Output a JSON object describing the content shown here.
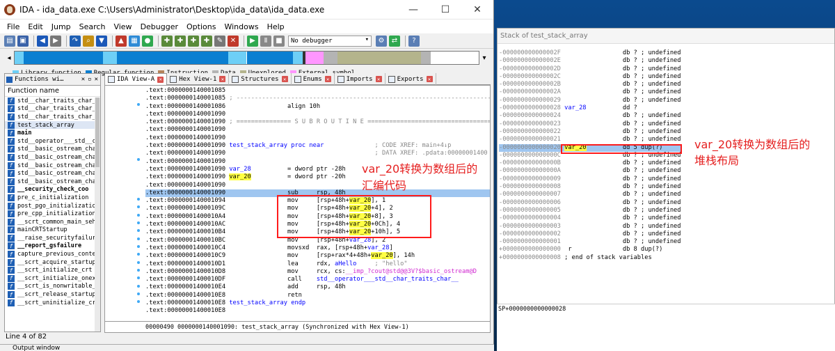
{
  "window": {
    "title": "IDA - ida_data.exe C:\\Users\\Administrator\\Desktop\\ida_data\\ida_data.exe",
    "min": "—",
    "max": "☐",
    "close": "✕"
  },
  "menu": [
    "File",
    "Edit",
    "Jump",
    "Search",
    "View",
    "Debugger",
    "Options",
    "Windows",
    "Help"
  ],
  "toolbar": {
    "debugger_select": "No debugger"
  },
  "legend": [
    {
      "label": "Library function",
      "color": "#6ecff6"
    },
    {
      "label": "Regular function",
      "color": "#0b7fd1"
    },
    {
      "label": "Instruction",
      "color": "#b5835a"
    },
    {
      "label": "Data",
      "color": "#b4b4b4"
    },
    {
      "label": "Unexplored",
      "color": "#b4b48c"
    },
    {
      "label": "External symbol",
      "color": "#ff96ff"
    }
  ],
  "functions": {
    "tab": "Functions wi…",
    "header": "Function name",
    "items": [
      {
        "name": "std__char_traits_char__",
        "bold": false,
        "sel": false
      },
      {
        "name": "std__char_traits_char__",
        "bold": false,
        "sel": false
      },
      {
        "name": "std__char_traits_char__",
        "bold": false,
        "sel": false
      },
      {
        "name": "test_stack_array",
        "bold": false,
        "sel": true
      },
      {
        "name": "main",
        "bold": true,
        "sel": false
      },
      {
        "name": "std__operator___std__ch",
        "bold": false,
        "sel": false
      },
      {
        "name": "std__basic_ostream_char",
        "bold": false,
        "sel": false
      },
      {
        "name": "std__basic_ostream_char",
        "bold": false,
        "sel": false
      },
      {
        "name": "std__basic_ostream_char",
        "bold": false,
        "sel": false
      },
      {
        "name": "std__basic_ostream_char",
        "bold": false,
        "sel": false
      },
      {
        "name": "std__basic_ostream_char",
        "bold": false,
        "sel": false
      },
      {
        "name": "__security_check_coo",
        "bold": true,
        "sel": false
      },
      {
        "name": "pre_c_initialization",
        "bold": false,
        "sel": false
      },
      {
        "name": "post_pgo_initializatio",
        "bold": false,
        "sel": false
      },
      {
        "name": "pre_cpp_initialization",
        "bold": false,
        "sel": false
      },
      {
        "name": "__scrt_common_main_seh",
        "bold": false,
        "sel": false
      },
      {
        "name": "mainCRTStartup",
        "bold": false,
        "sel": false
      },
      {
        "name": "__raise_securityfailure",
        "bold": false,
        "sel": false
      },
      {
        "name": "__report_gsfailure",
        "bold": true,
        "sel": false
      },
      {
        "name": "capture_previous_contex",
        "bold": false,
        "sel": false
      },
      {
        "name": "__scrt_acquire_startup_",
        "bold": false,
        "sel": false
      },
      {
        "name": "__scrt_initialize_crt",
        "bold": false,
        "sel": false
      },
      {
        "name": "__scrt_initialize_onexi",
        "bold": false,
        "sel": false
      },
      {
        "name": "__scrt_is_nonwritable_i",
        "bold": false,
        "sel": false
      },
      {
        "name": "__scrt_release_startup_",
        "bold": false,
        "sel": false
      },
      {
        "name": "__scrt_uninitialize_crt",
        "bold": false,
        "sel": false
      }
    ],
    "status": "Line 4 of 82"
  },
  "tabs": [
    {
      "label": "IDA View-A",
      "active": true
    },
    {
      "label": "Hex View-1",
      "active": false
    },
    {
      "label": "Structures",
      "active": false
    },
    {
      "label": "Enums",
      "active": false
    },
    {
      "label": "Imports",
      "active": false
    },
    {
      "label": "Exports",
      "active": false
    }
  ],
  "code_lines": [
    ".text:0000000140001085",
    ".text:0000000140001085 ; ---------------------------------------------------------------------------",
    ".text:0000000140001086                 align 10h",
    ".text:0000000140001090",
    ".text:0000000140001090 ; =============== S U B R O U T I N E =======================================",
    ".text:0000000140001090",
    ".text:0000000140001090",
    ".text:0000000140001090 test_stack_array proc near              ; CODE XREF: main+4↓p",
    ".text:0000000140001090                                         ; DATA XREF: .pdata:00000001400",
    ".text:0000000140001090",
    ".text:0000000140001090 var_28          = dword ptr -28h",
    ".text:0000000140001090 var_20          = dword ptr -20h",
    ".text:0000000140001090",
    ".text:0000000140001090                 sub     rsp, 48h",
    ".text:0000000140001094                 mov     [rsp+48h+var_20], 1",
    ".text:000000014000109C                 mov     [rsp+48h+var_20+4], 2",
    ".text:00000001400010A4                 mov     [rsp+48h+var_20+8], 3",
    ".text:00000001400010AC                 mov     [rsp+48h+var_20+0Ch], 4",
    ".text:00000001400010B4                 mov     [rsp+48h+var_20+10h], 5",
    ".text:00000001400010BC                 mov     [rsp+48h+var_28], 2",
    ".text:00000001400010C4                 movsxd  rax, [rsp+48h+var_28]",
    ".text:00000001400010C9                 mov     [rsp+rax*4+48h+var_20], 14h",
    ".text:00000001400010D1                 lea     rdx, aHello     ; \"hello\"",
    ".text:00000001400010D8                 mov     rcx, cs:__imp_?cout@std@@3V?$basic_ostream@D",
    ".text:00000001400010DF                 call    std__operator___std__char_traits_char__",
    ".text:00000001400010E4                 add     rsp, 48h",
    ".text:00000001400010E8                 retn",
    ".text:00000001400010E8 test_stack_array endp",
    ".text:00000001400010E8"
  ],
  "sync_status": "00000490 0000000140001090: test_stack_array (Synchronized with Hex View-1)",
  "annotation_left": [
    "var_20转换为数组后的",
    "汇编代码"
  ],
  "stack": {
    "title": "Stack of test_stack_array",
    "lines": [
      "-000000000000002F                 db ? ; undefined",
      "-000000000000002E                 db ? ; undefined",
      "-000000000000002D                 db ? ; undefined",
      "-000000000000002C                 db ? ; undefined",
      "-000000000000002B                 db ? ; undefined",
      "-000000000000002A                 db ? ; undefined",
      "-0000000000000029                 db ? ; undefined",
      "-0000000000000028 var_28          dd ?",
      "-0000000000000024                 db ? ; undefined",
      "-0000000000000023                 db ? ; undefined",
      "-0000000000000022                 db ? ; undefined",
      "-0000000000000021                 db ? ; undefined",
      "-0000000000000020 var_20          dd 5 dup(?)",
      "-000000000000000C                 db ? ; undefined",
      "-000000000000000B                 db ? ; undefined",
      "-000000000000000A                 db ? ; undefined",
      "-0000000000000009                 db ? ; undefined",
      "-0000000000000008                 db ? ; undefined",
      "-0000000000000007                 db ? ; undefined",
      "-0000000000000006                 db ? ; undefined",
      "-0000000000000005                 db ? ; undefined",
      "-0000000000000004                 db ? ; undefined",
      "-0000000000000003                 db ? ; undefined",
      "-0000000000000002                 db ? ; undefined",
      "-0000000000000001                 db ? ; undefined",
      "+0000000000000000  r              db 8 dup(?)",
      "+0000000000000008 ; end of stack variables"
    ],
    "sp": "SP+0000000000000028"
  },
  "annotation_right": [
    "var_20转换为数组后的",
    "堆栈布局"
  ],
  "output_window": "Output window"
}
